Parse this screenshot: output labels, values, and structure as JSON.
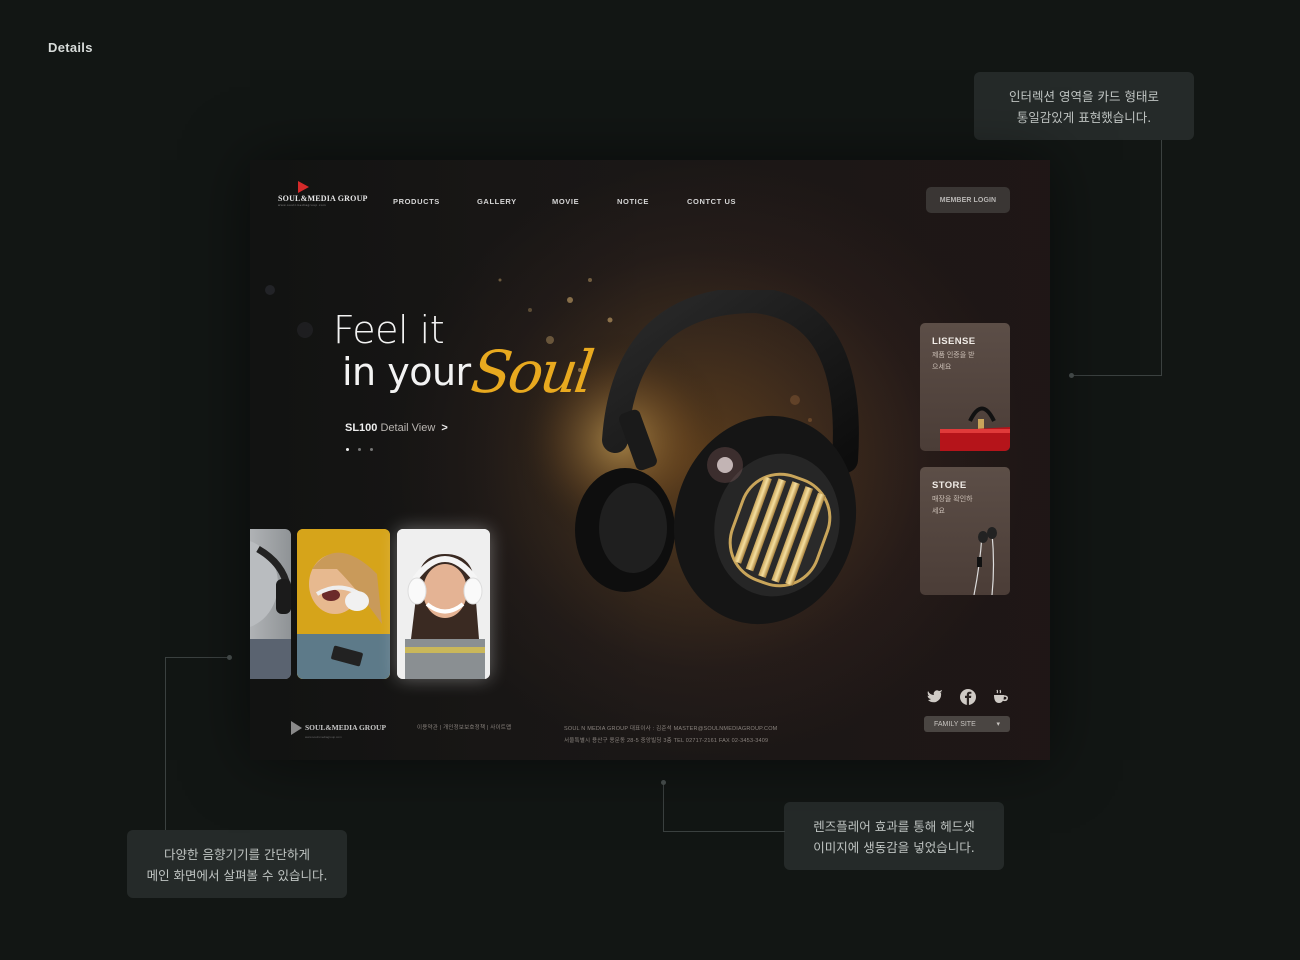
{
  "page": {
    "section_title": "Details"
  },
  "annotations": [
    {
      "lines": [
        "인터렉션 영역을 카드 형태로",
        "통일감있게 표현했습니다."
      ]
    },
    {
      "lines": [
        "다양한 음향기기를 간단하게",
        "메인 화면에서 살펴볼 수 있습니다."
      ]
    },
    {
      "lines": [
        "렌즈플레어 효과를 통해 헤드셋",
        "이미지에 생동감을 넣었습니다."
      ]
    }
  ],
  "site": {
    "logo": {
      "name": "SOUL&MEDIA GROUP",
      "tagline": "www.soulnmediagroup.com"
    },
    "nav": [
      "PRODUCTS",
      "GALLERY",
      "MOVIE",
      "NOTICE",
      "CONTCT US"
    ],
    "member_login": "MEMBER LOGIN",
    "hero": {
      "line1": "Feel it",
      "line2": "in your",
      "accent": "Soul",
      "detail_model": "SL100",
      "detail_label": "Detail View",
      "detail_chevron": ">"
    },
    "pager": {
      "count": 3,
      "active": 1
    },
    "side_cards": [
      {
        "title": "LISENSE",
        "desc": "제품 인증을 받으세요"
      },
      {
        "title": "STORE",
        "desc": "매장을 확인하세요"
      }
    ],
    "social_icons": [
      "twitter-icon",
      "facebook-icon",
      "coffee-icon"
    ],
    "family_site": {
      "label": "FAMILY SITE",
      "arrow": "▾"
    },
    "footer": {
      "links": "이용약관  |  개인정보보호정책  |  사이트맵",
      "info_line1": "SOUL N MEDIA GROUP  대표이사 : 김준석   MASTER@SOULNMEDIAGROUP.COM",
      "info_line2": "서울특별시 용산구 용문동 28-5 중앙빌딩 3층    TEL 02717-2161    FAX 02-3453-3409"
    },
    "colors": {
      "accent": "#e8a91f",
      "background": "#121614",
      "card": "#252a29"
    }
  }
}
